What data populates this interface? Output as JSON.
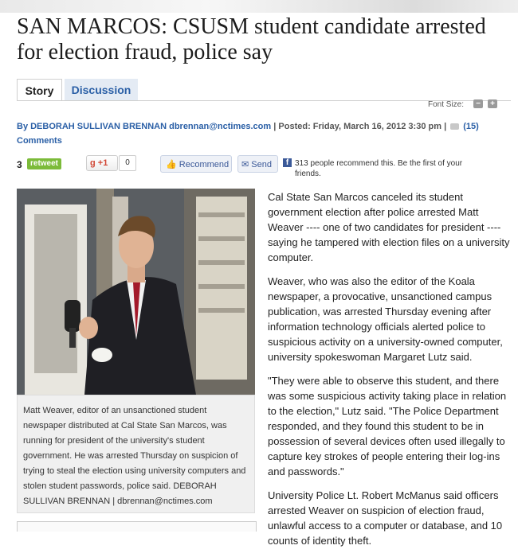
{
  "headline": "SAN MARCOS: CSUSM student candidate arrested for election fraud, police say",
  "tabs": {
    "story": "Story",
    "discussion": "Discussion"
  },
  "font_size": {
    "label": "Font Size:",
    "decrease": "−",
    "increase": "+"
  },
  "byline": {
    "author": "By DEBORAH SULLIVAN BRENNAN",
    "email": "dbrennan@nctimes.com",
    "separator": "|",
    "posted": "Posted: Friday, March 16, 2012 3:30 pm",
    "comments_count": "(15)",
    "comments_label": "Comments"
  },
  "share": {
    "retweet_count": "3",
    "retweet_label": "retweet",
    "gplus_label": "+1",
    "gplus_count": "0",
    "recommend_label": "Recommend",
    "send_label": "Send",
    "fb_text": "313 people recommend this. Be the first of your friends."
  },
  "photo": {
    "caption": "Matt Weaver, editor of an unsanctioned student newspaper distributed at Cal State San Marcos, was running for president of the university's student government. He was arrested Thursday on suspicion of trying to steal the election using university computers and stolen student passwords, police said. DEBORAH SULLIVAN BRENNAN | dbrennan@nctimes.com"
  },
  "article": {
    "paragraphs": [
      "Cal State San Marcos canceled its student government election after police arrested Matt Weaver ---- one of two candidates for president ---- saying he tampered with election files on a university computer.",
      "Weaver, who was also the editor of the Koala newspaper, a provocative, unsanctioned campus publication, was arrested Thursday evening after information technology officials alerted police to suspicious activity on a university-owned computer, university spokeswoman Margaret Lutz said.",
      "\"They were able to observe this student, and there was some suspicious activity taking place in relation to the election,\" Lutz said. \"The Police Department responded, and they found this student to be in possession of several devices often used illegally to capture key strokes of people entering their log-ins and passwords.\"",
      "University Police Lt. Robert McManus said officers arrested Weaver on suspicion of election fraud, unlawful access to a computer or database, and 10 counts of identity theft."
    ]
  },
  "colors": {
    "link": "#2a5fa6",
    "retweet": "#7cbb3a",
    "facebook": "#3b5998",
    "gplus": "#d14836"
  }
}
